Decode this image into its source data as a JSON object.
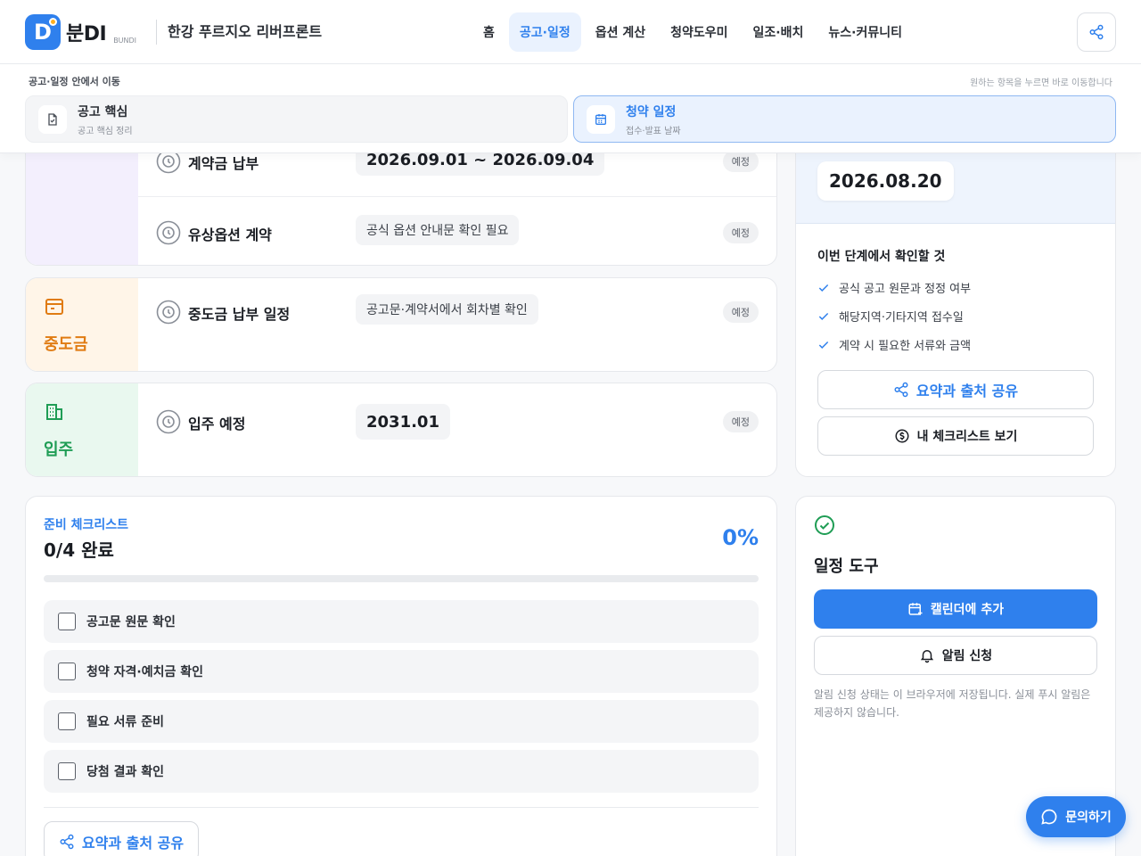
{
  "header": {
    "logo_letter": "D",
    "logo_text": "분DI",
    "logo_sub": "BUNDI",
    "site_name": "한강 푸르지오 리버프론트",
    "nav": [
      {
        "label": "홈",
        "active": false
      },
      {
        "label": "공고·일정",
        "active": true
      },
      {
        "label": "옵션 계산",
        "active": false
      },
      {
        "label": "청약도우미",
        "active": false
      },
      {
        "label": "일조·배치",
        "active": false
      },
      {
        "label": "뉴스·커뮤니티",
        "active": false
      }
    ]
  },
  "subnav": {
    "title": "공고·일정 안에서 이동",
    "hint": "원하는 항목을 누르면 바로 이동합니다",
    "cards": [
      {
        "title": "공고 핵심",
        "desc": "공고 핵심 정리",
        "icon": "document-icon",
        "active": false
      },
      {
        "title": "청약 일정",
        "desc": "접수·발표 날짜",
        "icon": "calendar-icon",
        "active": true
      }
    ]
  },
  "timeline": {
    "contract": {
      "rows": [
        {
          "name": "계약금 납부",
          "value": "2026.09.01 ~ 2026.09.04",
          "badge": "예정"
        },
        {
          "name": "유상옵션 계약",
          "value": "공식 옵션 안내문 확인 필요",
          "badge": "예정"
        }
      ]
    },
    "middle": {
      "label": "중도금",
      "color": "#e07b12",
      "rows": [
        {
          "name": "중도금 납부 일정",
          "value": "공고문·계약서에서 회차별 확인",
          "badge": "예정"
        }
      ]
    },
    "movein": {
      "label": "입주",
      "color": "#1f9d55",
      "rows": [
        {
          "name": "입주 예정",
          "value": "2031.01",
          "badge": "예정"
        }
      ]
    }
  },
  "side": {
    "date": "2026.08.20",
    "check_title": "이번 단계에서 확인할 것",
    "checks": [
      "공식 공고 원문과 정정 여부",
      "해당지역·기타지역 접수일",
      "계약 시 필요한 서류와 금액"
    ],
    "share_label": "요약과 출처 공유",
    "checklist_label": "내 체크리스트 보기"
  },
  "checklist": {
    "label": "준비 체크리스트",
    "count": "0/4 완료",
    "percent_text": "0%",
    "progress": 0,
    "items": [
      "공고문 원문 확인",
      "청약 자격·예치금 확인",
      "필요 서류 준비",
      "당첨 결과 확인"
    ],
    "share_label": "요약과 출처 공유"
  },
  "tools": {
    "title": "일정 도구",
    "calendar_label": "캘린더에 추가",
    "alarm_label": "알림 신청",
    "note": "알림 신청 상태는 이 브라우저에 저장됩니다. 실제 푸시 알림은 제공하지 않습니다."
  },
  "chat": {
    "label": "문의하기"
  },
  "colors": {
    "accent": "#2f80ed"
  }
}
